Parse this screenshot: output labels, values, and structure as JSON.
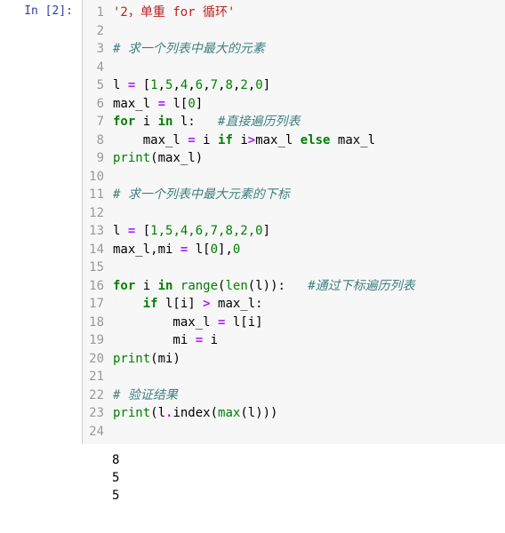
{
  "prompt": "In [2]:",
  "lines": [
    "1",
    "2",
    "3",
    "4",
    "5",
    "6",
    "7",
    "8",
    "9",
    "10",
    "11",
    "12",
    "13",
    "14",
    "15",
    "16",
    "17",
    "18",
    "19",
    "20",
    "21",
    "22",
    "23",
    "24"
  ],
  "code": {
    "l1_str": "'2，单重 for 循环'",
    "l3_com": "# 求一个列表中最大的元素",
    "l5_a": "l ",
    "l5_eq": "=",
    "l5_b": " [",
    "l5_n1": "1",
    "l5_c1": ",",
    "l5_n2": "5",
    "l5_c2": ",",
    "l5_n3": "4",
    "l5_c3": ",",
    "l5_n4": "6",
    "l5_c4": ",",
    "l5_n5": "7",
    "l5_c5": ",",
    "l5_n6": "8",
    "l5_c6": ",",
    "l5_n7": "2",
    "l5_c7": ",",
    "l5_n8": "0",
    "l5_d": "]",
    "l6_a": "max_l ",
    "l6_eq": "=",
    "l6_b": " l[",
    "l6_n": "0",
    "l6_c": "]",
    "l7_for": "for",
    "l7_a": " i ",
    "l7_in": "in",
    "l7_b": " l:   ",
    "l7_com": "#直接遍历列表",
    "l8_ind": "    max_l ",
    "l8_eq": "=",
    "l8_a": " i ",
    "l8_if": "if",
    "l8_b": " i",
    "l8_gt": ">",
    "l8_c": "max_l ",
    "l8_else": "else",
    "l8_d": " max_l",
    "l9_print": "print",
    "l9_a": "(max_l)",
    "l11_com": "# 求一个列表中最大元素的下标",
    "l13_a": "l ",
    "l13_eq": "=",
    "l13_b": " [",
    "l13_list": "1,5,4,6,7,8,2,0",
    "l13_c": "]",
    "l14_a": "max_l,mi ",
    "l14_eq": "=",
    "l14_b": " l[",
    "l14_n1": "0",
    "l14_c": "],",
    "l14_n2": "0",
    "l16_for": "for",
    "l16_a": " i ",
    "l16_in": "in",
    "l16_b": " ",
    "l16_range": "range",
    "l16_c": "(",
    "l16_len": "len",
    "l16_d": "(l)):   ",
    "l16_com": "#通过下标遍历列表",
    "l17_ind": "    ",
    "l17_if": "if",
    "l17_a": " l[i] ",
    "l17_gt": ">",
    "l17_b": " max_l:",
    "l18_a": "        max_l ",
    "l18_eq": "=",
    "l18_b": " l[i]",
    "l19_a": "        mi ",
    "l19_eq": "=",
    "l19_b": " i",
    "l20_print": "print",
    "l20_a": "(mi)",
    "l22_com": "# 验证结果",
    "l23_print": "print",
    "l23_a": "(l",
    "l23_dot": ".",
    "l23_index": "index",
    "l23_b": "(",
    "l23_max": "max",
    "l23_c": "(l)))"
  },
  "output": "8\n5\n5"
}
